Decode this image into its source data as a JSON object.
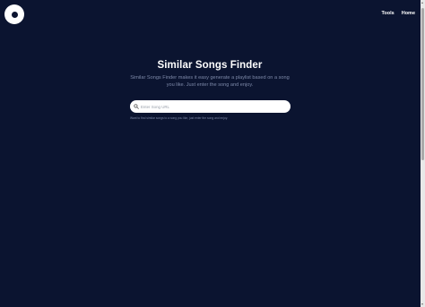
{
  "logo": {
    "icon": "vinyl-record-icon"
  },
  "nav": {
    "tools_label": "Tools",
    "home_label": "Home"
  },
  "hero": {
    "title": "Similar Songs Finder",
    "subtitle": "Similar Songs Finder makes it easy generate a playlist based on a song you like. Just enter the song and enjoy."
  },
  "search": {
    "icon": "search-icon",
    "placeholder": "Enter Song URL",
    "value": "",
    "help_text": "Want to find similar songs to a song you like, just enter the song and enjoy."
  },
  "colors": {
    "background": "#0b1430",
    "text_primary": "#ffffff",
    "text_muted": "#7d89a8"
  }
}
